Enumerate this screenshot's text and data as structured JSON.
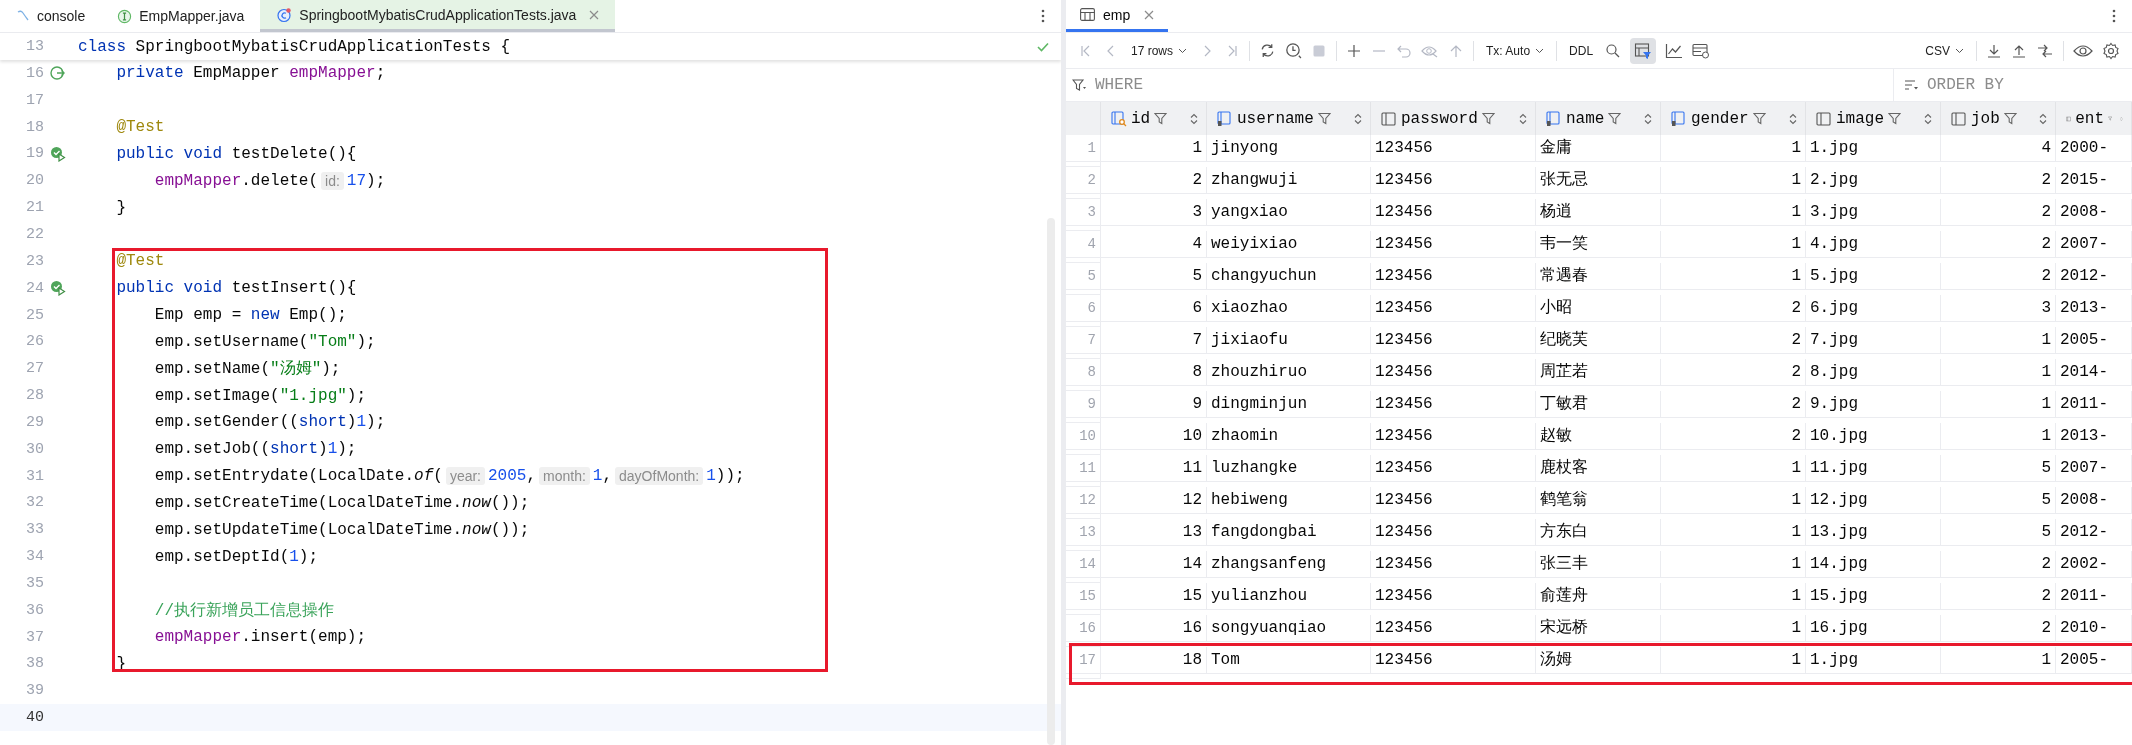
{
  "editor": {
    "tabs": [
      {
        "label": "console",
        "kind": "console",
        "selected": false
      },
      {
        "label": "EmpMapper.java",
        "kind": "interface",
        "selected": false
      },
      {
        "label": "SpringbootMybatisCrudApplicationTests.java",
        "kind": "test-class",
        "selected": true
      }
    ],
    "sticky_line": {
      "number": "13",
      "inspection_ok": true,
      "tokens": [
        {
          "kind": "keyword",
          "text": "class"
        },
        {
          "kind": "plain",
          "text": " SpringbootMybatisCrudApplicationTests {"
        }
      ]
    },
    "lines": [
      {
        "number": "16",
        "kind": "bean",
        "tokens": [
          {
            "kind": "keyword",
            "text": "    private"
          },
          {
            "kind": "plain",
            "text": " EmpMapper "
          },
          {
            "kind": "field",
            "text": "empMapper"
          },
          {
            "kind": "plain",
            "text": ";"
          }
        ]
      },
      {
        "number": "17",
        "kind": "plain"
      },
      {
        "number": "18",
        "kind": "plain",
        "tokens": [
          {
            "kind": "annotation",
            "text": "    @Test"
          }
        ]
      },
      {
        "number": "19",
        "kind": "run",
        "tokens": [
          {
            "kind": "keyword",
            "text": "    public void"
          },
          {
            "kind": "plain",
            "text": " testDelete(){"
          }
        ]
      },
      {
        "number": "20",
        "kind": "plain",
        "tokens": [
          {
            "kind": "field",
            "text": "        empMapper"
          },
          {
            "kind": "plain",
            "text": ".delete("
          },
          {
            "kind": "hint",
            "text": "id:"
          },
          {
            "kind": "number",
            "text": "17"
          },
          {
            "kind": "plain",
            "text": ");"
          }
        ]
      },
      {
        "number": "21",
        "kind": "plain",
        "tokens": [
          {
            "kind": "plain",
            "text": "    }"
          }
        ]
      },
      {
        "number": "22",
        "kind": "plain"
      },
      {
        "kind": "highlight",
        "lines": [
          {
            "number": "23",
            "kind": "plain",
            "tokens": [
              {
                "kind": "annotation",
                "text": "    @Test"
              }
            ]
          },
          {
            "number": "24",
            "kind": "run",
            "tokens": [
              {
                "kind": "keyword",
                "text": "    public void"
              },
              {
                "kind": "plain",
                "text": " testInsert(){"
              }
            ]
          },
          {
            "number": "25",
            "kind": "plain",
            "tokens": [
              {
                "kind": "plain",
                "text": "        Emp emp = "
              },
              {
                "kind": "keyword",
                "text": "new"
              },
              {
                "kind": "plain",
                "text": " Emp();"
              }
            ]
          },
          {
            "number": "26",
            "kind": "plain",
            "tokens": [
              {
                "kind": "plain",
                "text": "        emp.setUsername("
              },
              {
                "kind": "string",
                "text": "\"Tom\""
              },
              {
                "kind": "plain",
                "text": ");"
              }
            ]
          },
          {
            "number": "27",
            "kind": "plain",
            "tokens": [
              {
                "kind": "plain",
                "text": "        emp.setName("
              },
              {
                "kind": "string",
                "text": "\"汤姆\""
              },
              {
                "kind": "plain",
                "text": ");"
              }
            ]
          },
          {
            "number": "28",
            "kind": "plain",
            "tokens": [
              {
                "kind": "plain",
                "text": "        emp.setImage("
              },
              {
                "kind": "string",
                "text": "\"1.jpg\""
              },
              {
                "kind": "plain",
                "text": ");"
              }
            ]
          },
          {
            "number": "29",
            "kind": "plain",
            "tokens": [
              {
                "kind": "plain",
                "text": "        emp.setGender(("
              },
              {
                "kind": "keyword",
                "text": "short"
              },
              {
                "kind": "plain",
                "text": ")"
              },
              {
                "kind": "number",
                "text": "1"
              },
              {
                "kind": "plain",
                "text": ");"
              }
            ]
          },
          {
            "number": "30",
            "kind": "plain",
            "tokens": [
              {
                "kind": "plain",
                "text": "        emp.setJob(("
              },
              {
                "kind": "keyword",
                "text": "short"
              },
              {
                "kind": "plain",
                "text": ")"
              },
              {
                "kind": "number",
                "text": "1"
              },
              {
                "kind": "plain",
                "text": ");"
              }
            ]
          },
          {
            "number": "31",
            "kind": "plain",
            "tokens": [
              {
                "kind": "plain",
                "text": "        emp.setEntrydate(LocalDate."
              },
              {
                "kind": "static",
                "text": "of"
              },
              {
                "kind": "plain",
                "text": "("
              },
              {
                "kind": "hint",
                "text": "year:"
              },
              {
                "kind": "number",
                "text": "2005"
              },
              {
                "kind": "plain",
                "text": ","
              },
              {
                "kind": "hint",
                "text": "month:"
              },
              {
                "kind": "number",
                "text": "1"
              },
              {
                "kind": "plain",
                "text": ","
              },
              {
                "kind": "hint",
                "text": "dayOfMonth:"
              },
              {
                "kind": "number",
                "text": "1"
              },
              {
                "kind": "plain",
                "text": "));"
              }
            ]
          },
          {
            "number": "32",
            "kind": "plain",
            "tokens": [
              {
                "kind": "plain",
                "text": "        emp.setCreateTime(LocalDateTime."
              },
              {
                "kind": "static",
                "text": "now"
              },
              {
                "kind": "plain",
                "text": "());"
              }
            ]
          },
          {
            "number": "33",
            "kind": "plain",
            "tokens": [
              {
                "kind": "plain",
                "text": "        emp.setUpdateTime(LocalDateTime."
              },
              {
                "kind": "static",
                "text": "now"
              },
              {
                "kind": "plain",
                "text": "());"
              }
            ]
          },
          {
            "number": "34",
            "kind": "plain",
            "tokens": [
              {
                "kind": "plain",
                "text": "        emp.setDeptId("
              },
              {
                "kind": "number",
                "text": "1"
              },
              {
                "kind": "plain",
                "text": ");"
              }
            ]
          },
          {
            "number": "35",
            "kind": "plain"
          },
          {
            "number": "36",
            "kind": "plain",
            "tokens": [
              {
                "kind": "comment",
                "text": "        //执行新增员工信息操作"
              }
            ]
          },
          {
            "number": "37",
            "kind": "plain",
            "tokens": [
              {
                "kind": "field",
                "text": "        empMapper"
              },
              {
                "kind": "plain",
                "text": ".insert(emp);"
              }
            ]
          },
          {
            "number": "38",
            "kind": "plain",
            "tokens": [
              {
                "kind": "plain",
                "text": "    }"
              }
            ]
          }
        ]
      },
      {
        "number": "39",
        "kind": "plain"
      },
      {
        "number": "40",
        "kind": "plain",
        "current": true
      }
    ]
  },
  "results": {
    "tab": {
      "label": "emp",
      "selected": true
    },
    "toolbar": {
      "rows_label": "17 rows",
      "paging_enabled": false,
      "tx_mode": "Tx: Auto",
      "ddl": "DDL",
      "filter_panel_on": true,
      "export_format": "CSV"
    },
    "where_placeholder": "WHERE",
    "order_by_placeholder": "ORDER BY",
    "columns": [
      {
        "name": "id",
        "kind": "primary",
        "numeric": true
      },
      {
        "name": "username",
        "kind": "indexed",
        "numeric": false
      },
      {
        "name": "password",
        "kind": "plain",
        "numeric": false
      },
      {
        "name": "name",
        "kind": "indexed",
        "numeric": false
      },
      {
        "name": "gender",
        "kind": "indexed",
        "numeric": true
      },
      {
        "name": "image",
        "kind": "plain",
        "numeric": false
      },
      {
        "name": "job",
        "kind": "plain",
        "numeric": true
      },
      {
        "name": "ent",
        "kind": "plain",
        "numeric": false
      }
    ],
    "rows": [
      {
        "number": "1",
        "cells": [
          "1",
          "jinyong",
          "123456",
          "金庸",
          "1",
          "1.jpg",
          "4",
          "2000-"
        ]
      },
      {
        "number": "2",
        "cells": [
          "2",
          "zhangwuji",
          "123456",
          "张无忌",
          "1",
          "2.jpg",
          "2",
          "2015-"
        ]
      },
      {
        "number": "3",
        "cells": [
          "3",
          "yangxiao",
          "123456",
          "杨逍",
          "1",
          "3.jpg",
          "2",
          "2008-"
        ]
      },
      {
        "number": "4",
        "cells": [
          "4",
          "weiyixiao",
          "123456",
          "韦一笑",
          "1",
          "4.jpg",
          "2",
          "2007-"
        ]
      },
      {
        "number": "5",
        "cells": [
          "5",
          "changyuchun",
          "123456",
          "常遇春",
          "1",
          "5.jpg",
          "2",
          "2012-"
        ]
      },
      {
        "number": "6",
        "cells": [
          "6",
          "xiaozhao",
          "123456",
          "小昭",
          "2",
          "6.jpg",
          "3",
          "2013-"
        ]
      },
      {
        "number": "7",
        "cells": [
          "7",
          "jixiaofu",
          "123456",
          "纪晓芙",
          "2",
          "7.jpg",
          "1",
          "2005-"
        ]
      },
      {
        "number": "8",
        "cells": [
          "8",
          "zhouzhiruo",
          "123456",
          "周芷若",
          "2",
          "8.jpg",
          "1",
          "2014-"
        ]
      },
      {
        "number": "9",
        "cells": [
          "9",
          "dingminjun",
          "123456",
          "丁敏君",
          "2",
          "9.jpg",
          "1",
          "2011-"
        ]
      },
      {
        "number": "10",
        "cells": [
          "10",
          "zhaomin",
          "123456",
          "赵敏",
          "2",
          "10.jpg",
          "1",
          "2013-"
        ]
      },
      {
        "number": "11",
        "cells": [
          "11",
          "luzhangke",
          "123456",
          "鹿杖客",
          "1",
          "11.jpg",
          "5",
          "2007-"
        ]
      },
      {
        "number": "12",
        "cells": [
          "12",
          "hebiweng",
          "123456",
          "鹤笔翁",
          "1",
          "12.jpg",
          "5",
          "2008-"
        ]
      },
      {
        "number": "13",
        "cells": [
          "13",
          "fangdongbai",
          "123456",
          "方东白",
          "1",
          "13.jpg",
          "5",
          "2012-"
        ]
      },
      {
        "number": "14",
        "cells": [
          "14",
          "zhangsanfeng",
          "123456",
          "张三丰",
          "1",
          "14.jpg",
          "2",
          "2002-"
        ]
      },
      {
        "number": "15",
        "cells": [
          "15",
          "yulianzhou",
          "123456",
          "俞莲舟",
          "1",
          "15.jpg",
          "2",
          "2011-"
        ]
      },
      {
        "number": "16",
        "cells": [
          "16",
          "songyuanqiao",
          "123456",
          "宋远桥",
          "1",
          "16.jpg",
          "2",
          "2010-"
        ]
      },
      {
        "number": "17",
        "boxed": true,
        "cells": [
          "18",
          "Tom",
          "123456",
          "汤姆",
          "1",
          "1.jpg",
          "1",
          "2005-"
        ]
      }
    ]
  }
}
